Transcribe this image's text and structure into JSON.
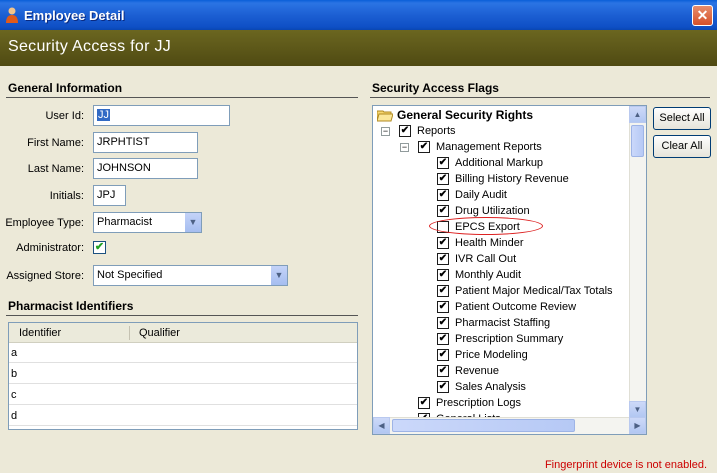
{
  "window": {
    "title": "Employee Detail",
    "close_glyph": "✕"
  },
  "header": {
    "title": "Security Access for JJ"
  },
  "general": {
    "section_title": "General Information",
    "user_id_label": "User Id:",
    "user_id_value": "JJ",
    "first_name_label": "First Name:",
    "first_name_value": "JRPHTIST",
    "last_name_label": "Last Name:",
    "last_name_value": "JOHNSON",
    "initials_label": "Initials:",
    "initials_value": "JPJ",
    "employee_type_label": "Employee Type:",
    "employee_type_value": "Pharmacist",
    "administrator_label": "Administrator:",
    "administrator_checked": "✔",
    "assigned_store_label": "Assigned Store:",
    "assigned_store_value": "Not Specified"
  },
  "identifiers": {
    "section_title": "Pharmacist Identifiers",
    "columns": [
      "Identifier",
      "Qualifier"
    ],
    "rows": [
      "a",
      "b",
      "c",
      "d"
    ]
  },
  "flags": {
    "section_title": "Security Access Flags",
    "root_label": "General Security Rights",
    "reports_label": "Reports",
    "management_label": "Management Reports",
    "items": [
      {
        "label": "Additional Markup",
        "checked": "✔"
      },
      {
        "label": "Billing History Revenue",
        "checked": "✔"
      },
      {
        "label": "Daily Audit",
        "checked": "✔"
      },
      {
        "label": "Drug Utilization",
        "checked": "✔"
      },
      {
        "label": "EPCS Export",
        "checked": ""
      },
      {
        "label": "Health Minder",
        "checked": "✔"
      },
      {
        "label": "IVR Call Out",
        "checked": "✔"
      },
      {
        "label": "Monthly Audit",
        "checked": "✔"
      },
      {
        "label": "Patient Major Medical/Tax Totals",
        "checked": "✔"
      },
      {
        "label": "Patient Outcome Review",
        "checked": "✔"
      },
      {
        "label": "Pharmacist Staffing",
        "checked": "✔"
      },
      {
        "label": "Prescription Summary",
        "checked": "✔"
      },
      {
        "label": "Price Modeling",
        "checked": "✔"
      },
      {
        "label": "Revenue",
        "checked": "✔"
      },
      {
        "label": "Sales Analysis",
        "checked": "✔"
      }
    ],
    "prescription_logs_label": "Prescription Logs",
    "general_lists_label": "General Lists",
    "select_all_label": "Select All",
    "clear_all_label": "Clear All"
  },
  "status": {
    "message": "Fingerprint device is not enabled."
  },
  "colors": {
    "header_band": "#4f4a12",
    "title_bar": "#0e4fc5",
    "status_text": "#cc0000",
    "highlight_ellipse": "#dd2222"
  }
}
